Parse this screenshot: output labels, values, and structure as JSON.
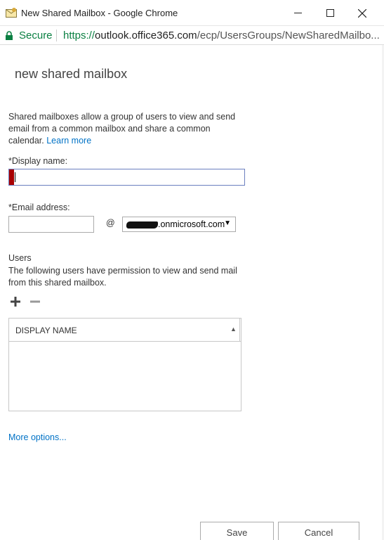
{
  "window": {
    "title": "New Shared Mailbox - Google Chrome"
  },
  "address_bar": {
    "secure_label": "Secure",
    "url_scheme": "https://",
    "url_host": "outlook.office365.com",
    "url_path": "/ecp/UsersGroups/NewSharedMailbo..."
  },
  "form": {
    "title": "new shared mailbox",
    "intro_text": "Shared mailboxes allow a group of users to view and send email from a common mailbox and share a common calendar.",
    "learn_more": "Learn more",
    "display_name_label": "*Display name:",
    "display_name_value": "",
    "email_label": "*Email address:",
    "email_value": "",
    "at_sign": "@",
    "domain_selected": ".onmicrosoft.com",
    "users_heading": "Users",
    "users_description": "The following users have permission to view and send mail from this shared mailbox.",
    "users_table": {
      "columns": [
        "DISPLAY NAME"
      ],
      "rows": []
    },
    "more_options": "More options...",
    "save_label": "Save",
    "cancel_label": "Cancel"
  },
  "colors": {
    "link": "#0072c6",
    "secure_green": "#0b8043",
    "required_marker": "#a80000",
    "focus_border": "#6b7fbf"
  }
}
